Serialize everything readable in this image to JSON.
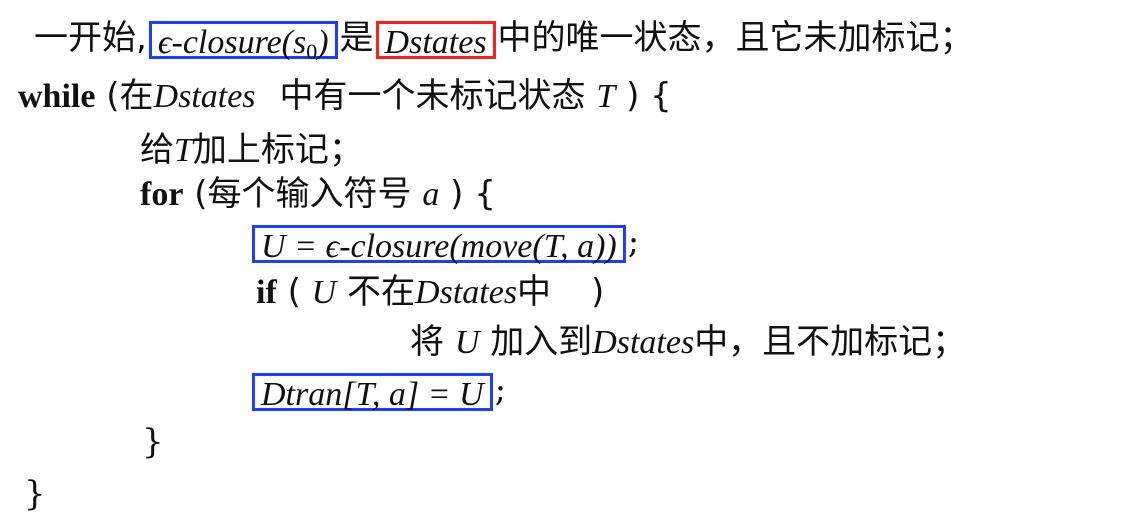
{
  "line1": {
    "prefix": "一开始,",
    "boxed_closure": "ϵ-closure(s",
    "boxed_closure_sub": "0",
    "boxed_closure_end": ")",
    "mid": "是",
    "boxed_dstates": "Dstates",
    "suffix": "中的唯一状态，且它未加标记；"
  },
  "line2": {
    "keyword": "while",
    "open": "(在",
    "dstates": "Dstates",
    "rest": "中有一个未标记状态",
    "var": "T",
    "close": ") {"
  },
  "line3": {
    "prefix": "给",
    "var": "T",
    "suffix": "加上标记；"
  },
  "line4": {
    "keyword": "for",
    "open": "(每个输入符号",
    "var": "a",
    "close": ") {"
  },
  "line5": {
    "boxed_expr": "U = ϵ-closure(move(T, a))",
    "suffix": ";"
  },
  "line6": {
    "keyword": "if",
    "open": "(",
    "var": "U",
    "mid": "不在",
    "dstates": "Dstates",
    "suffix": "中",
    "close": ")"
  },
  "line7": {
    "prefix": "将",
    "var": "U",
    "mid": "加入到",
    "dstates": "Dstates",
    "suffix": "中，且不加标记；"
  },
  "line8": {
    "boxed_expr": "Dtran[T, a] = U",
    "suffix": ";"
  },
  "line9": {
    "brace": "}"
  },
  "line10": {
    "brace": "}"
  },
  "colors": {
    "highlight_blue": "#1f3cff",
    "highlight_red": "#ff1f1f",
    "text": "#111111"
  }
}
